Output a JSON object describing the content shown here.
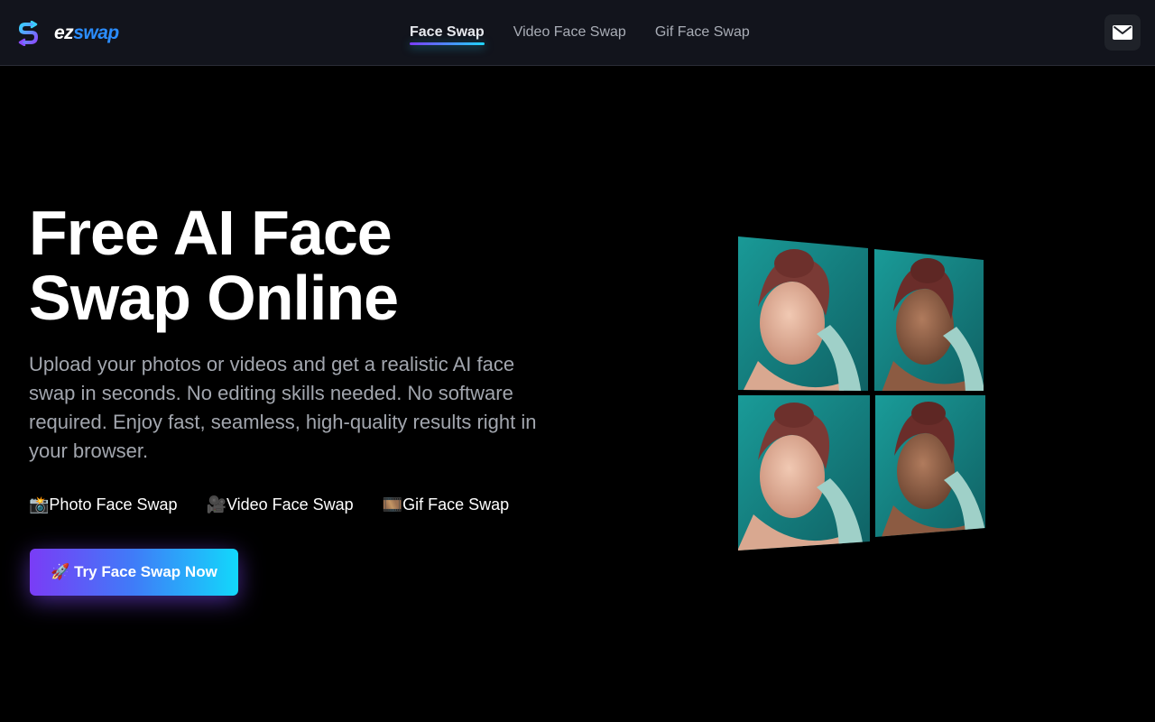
{
  "brand": {
    "name_part1": "ez",
    "name_part2": "swap"
  },
  "nav": {
    "items": [
      {
        "label": "Face Swap",
        "active": true
      },
      {
        "label": "Video Face Swap",
        "active": false
      },
      {
        "label": "Gif Face Swap",
        "active": false
      }
    ]
  },
  "hero": {
    "title_line1": "Free AI Face",
    "title_line2": "Swap Online",
    "description": "Upload your photos or videos and get a realistic AI face swap in seconds. No editing skills needed. No software required. Enjoy fast, seamless, high-quality results right in your browser.",
    "features": [
      {
        "emoji": "📸",
        "label": "Photo Face Swap"
      },
      {
        "emoji": "🎥",
        "label": "Video Face Swap"
      },
      {
        "emoji": "🎞️",
        "label": "Gif Face Swap"
      }
    ],
    "cta_label": "🚀 Try Face Swap Now"
  },
  "colors": {
    "accent_purple": "#7a3cf6",
    "accent_cyan": "#12d8fb",
    "brand_blue": "#2b8dff",
    "photo_bg_teal": "#1b8a88"
  },
  "icons": {
    "mail": "mail-icon",
    "logo": "ezswap-logo-icon"
  }
}
